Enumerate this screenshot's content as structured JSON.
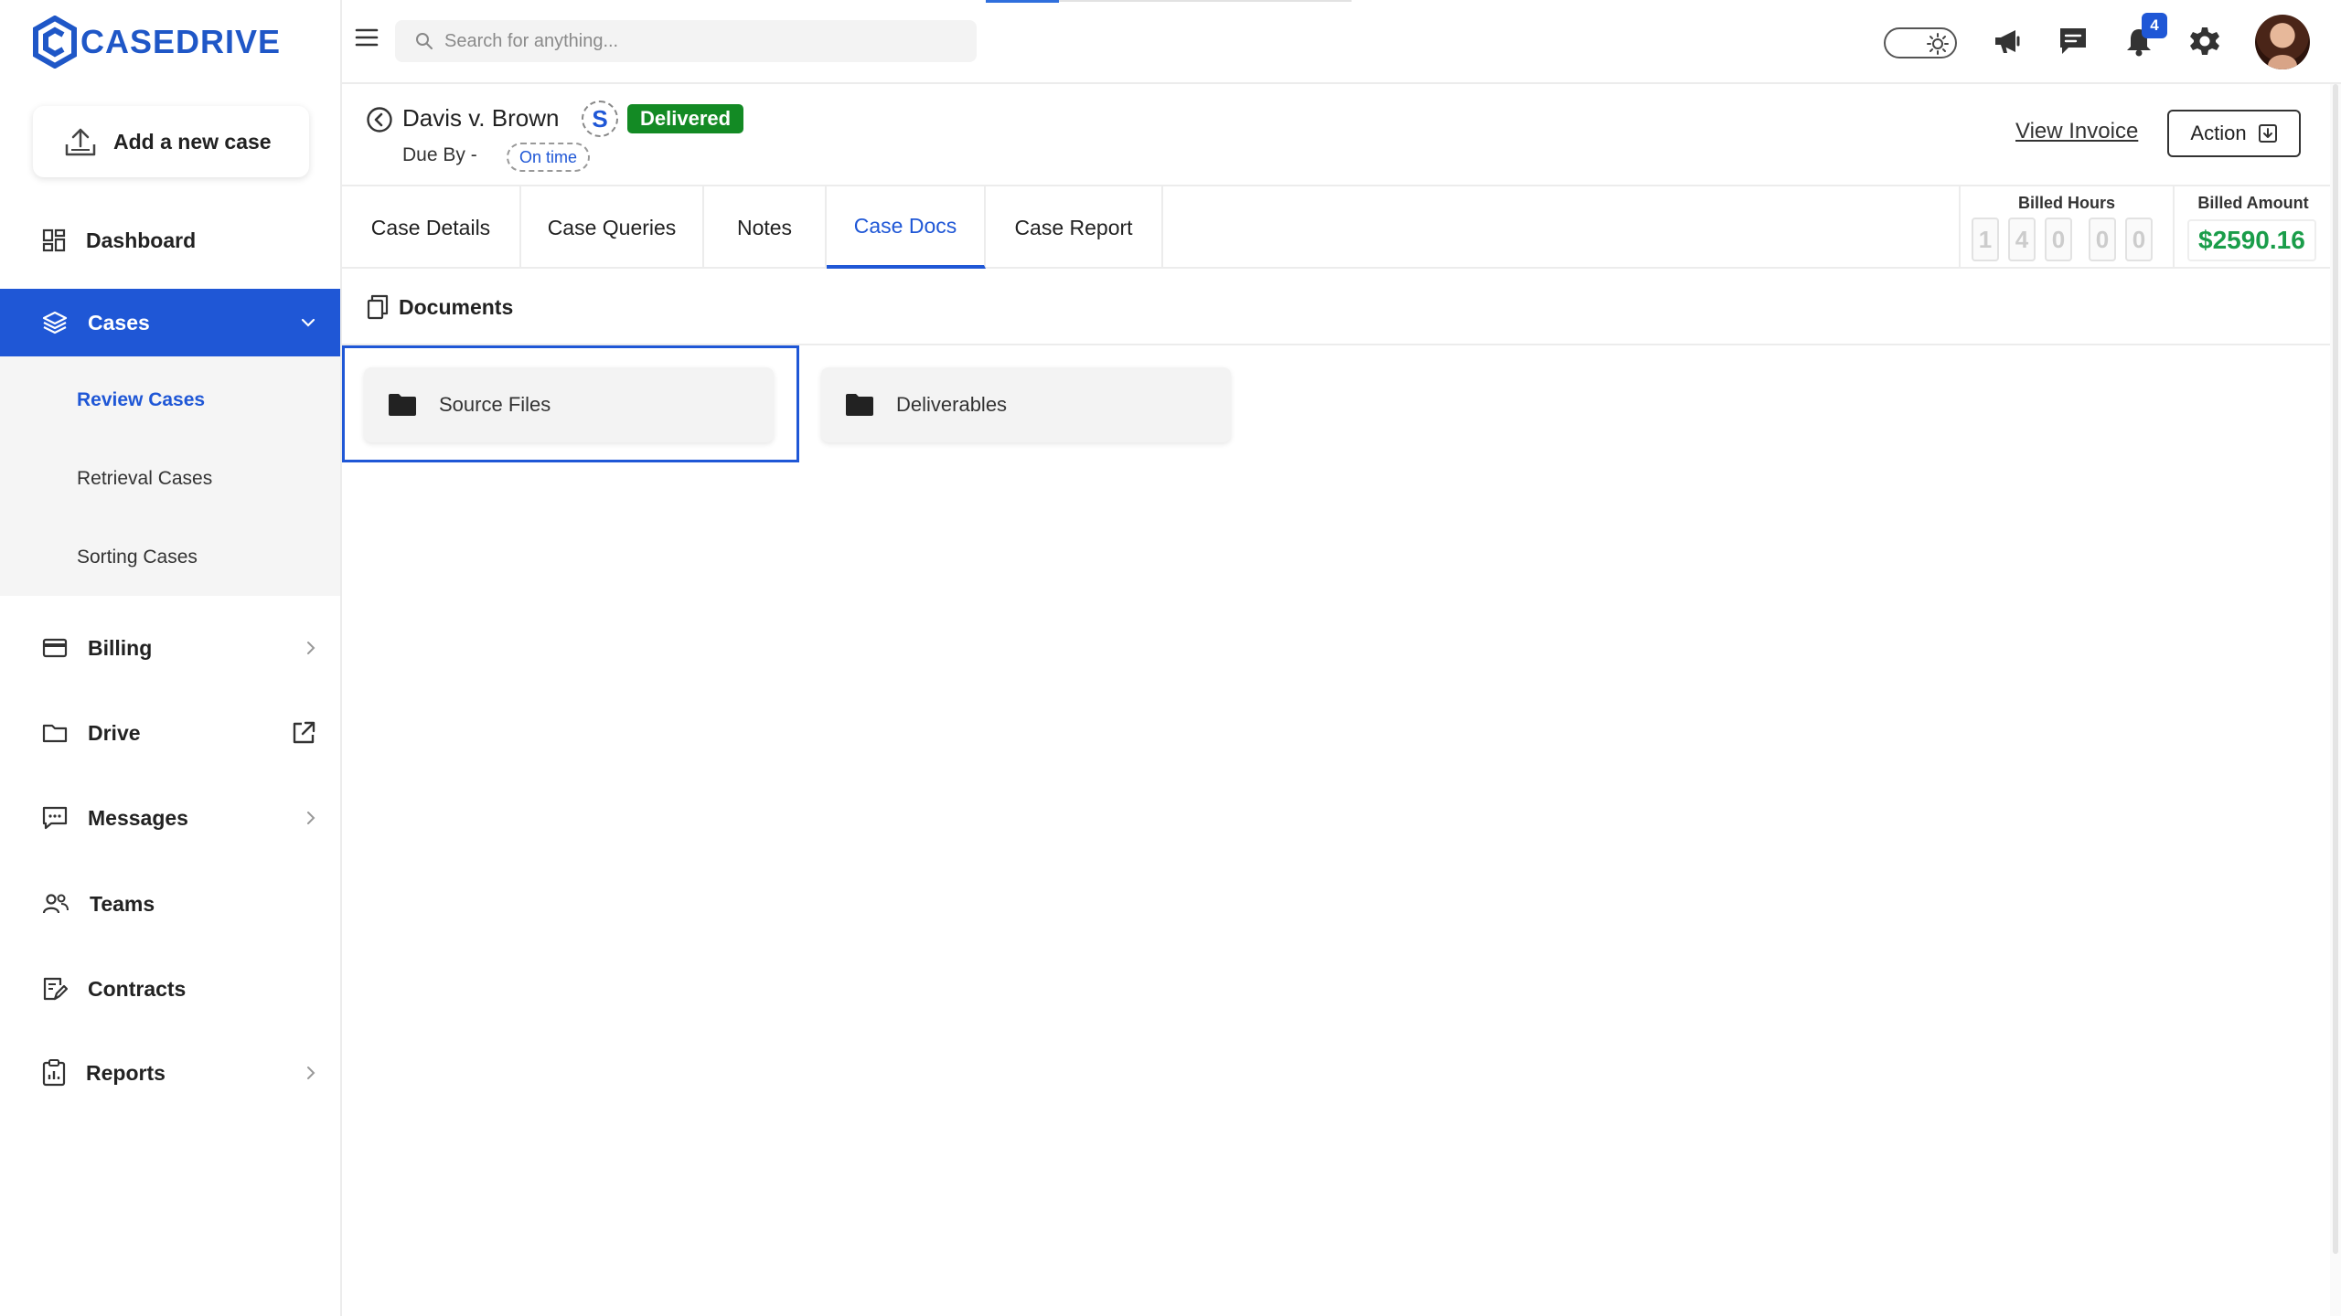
{
  "app": {
    "brand": "CASEDRIVE"
  },
  "sidebar": {
    "add_case_label": "Add a new case",
    "items": [
      {
        "label": "Dashboard"
      },
      {
        "label": "Cases"
      },
      {
        "label": "Billing"
      },
      {
        "label": "Drive"
      },
      {
        "label": "Messages"
      },
      {
        "label": "Teams"
      },
      {
        "label": "Contracts"
      },
      {
        "label": "Reports"
      }
    ],
    "cases_sub": [
      {
        "label": "Review Cases"
      },
      {
        "label": "Retrieval Cases"
      },
      {
        "label": "Sorting Cases"
      }
    ]
  },
  "header": {
    "search_placeholder": "Search for anything...",
    "notification_count": "4"
  },
  "case": {
    "title": "Davis v. Brown",
    "service_badge": "S",
    "status": "Delivered",
    "due_label": "Due By -",
    "due_status": "On time",
    "view_invoice": "View Invoice",
    "action_label": "Action"
  },
  "tabs": [
    {
      "label": "Case Details"
    },
    {
      "label": "Case Queries"
    },
    {
      "label": "Notes"
    },
    {
      "label": "Case Docs"
    },
    {
      "label": "Case Report"
    }
  ],
  "billing": {
    "hours_label": "Billed Hours",
    "hours_digits": [
      "1",
      "4",
      "0",
      "0",
      "0"
    ],
    "amount_label": "Billed Amount",
    "amount": "$2590.16"
  },
  "documents": {
    "title": "Documents",
    "folders": [
      {
        "name": "Source Files"
      },
      {
        "name": "Deliverables"
      }
    ]
  },
  "colors": {
    "accent": "#1f57d6",
    "status_delivered": "#138a24",
    "amount": "#1a9d4a"
  }
}
